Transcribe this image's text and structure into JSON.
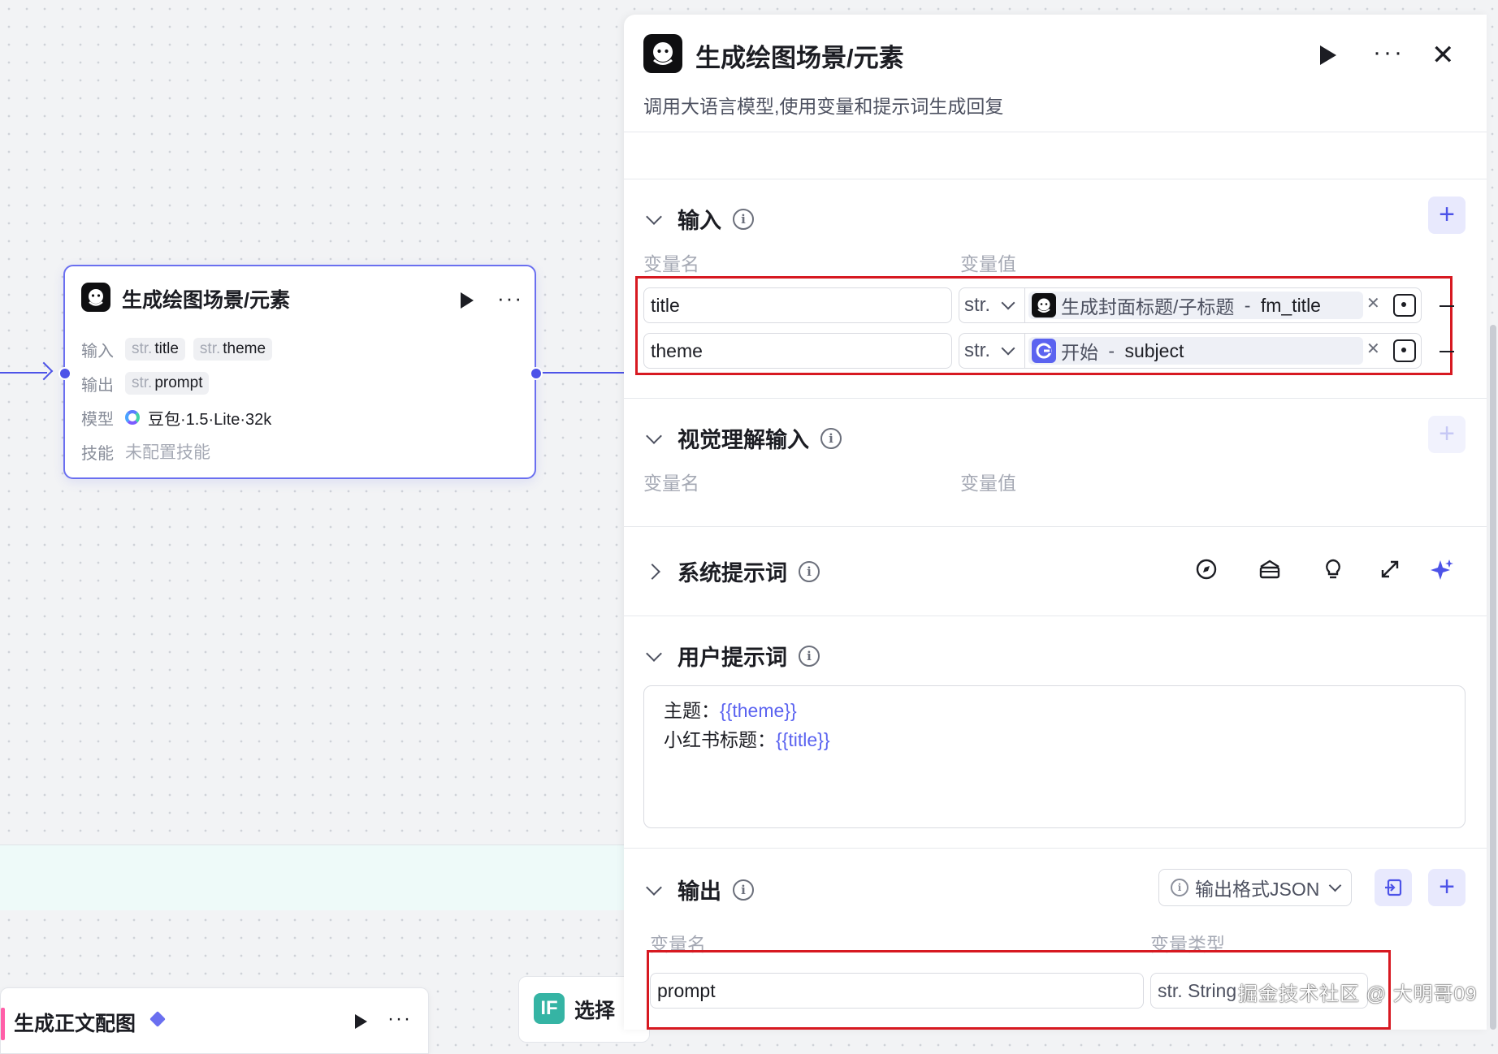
{
  "canvas": {
    "node": {
      "title": "生成绘图场景/元素",
      "input_label": "输入",
      "inputs": [
        {
          "type": "str.",
          "name": "title"
        },
        {
          "type": "str.",
          "name": "theme"
        }
      ],
      "output_label": "输出",
      "outputs": [
        {
          "type": "str.",
          "name": "prompt"
        }
      ],
      "model_label": "模型",
      "model_value": "豆包·1.5·Lite·32k",
      "skill_label": "技能",
      "skill_value": "未配置技能"
    },
    "node2": {
      "title": "生成正文配图"
    },
    "node3": {
      "icon_text": "IF",
      "title": "选择"
    }
  },
  "panel": {
    "title": "生成绘图场景/元素",
    "description": "调用大语言模型,使用变量和提示词生成回复",
    "close_icon": "✕",
    "input_section": {
      "title": "输入",
      "col_name": "变量名",
      "col_value": "变量值",
      "rows": [
        {
          "name": "title",
          "type": "str.",
          "source_node": "生成封面标题/子标题",
          "separator": " - ",
          "source_var": "fm_title",
          "icon": "node-avatar-icon"
        },
        {
          "name": "theme",
          "type": "str.",
          "source_node": "开始",
          "separator": " - ",
          "source_var": "subject",
          "icon": "start-node-icon"
        }
      ]
    },
    "vision_section": {
      "title": "视觉理解输入",
      "col_name": "变量名",
      "col_value": "变量值"
    },
    "system_prompt_section": {
      "title": "系统提示词",
      "tools": [
        "compass-icon",
        "library-icon",
        "lightbulb-icon",
        "expand-icon",
        "sparkle-icon"
      ]
    },
    "user_prompt_section": {
      "title": "用户提示词",
      "lines": [
        {
          "label": "主题：",
          "var": "{{theme}}"
        },
        {
          "label": "小红书标题：",
          "var": "{{title}}"
        }
      ]
    },
    "output_section": {
      "title": "输出",
      "format_button": "输出格式JSON",
      "col_name": "变量名",
      "col_type": "变量类型",
      "rows": [
        {
          "name": "prompt",
          "type": "str. String"
        }
      ]
    }
  },
  "watermark": "掘金技术社区 @ 大明哥09",
  "colors": {
    "accent": "#4d53e8",
    "highlight_box": "#d71921",
    "variable": "#5b63f0"
  }
}
